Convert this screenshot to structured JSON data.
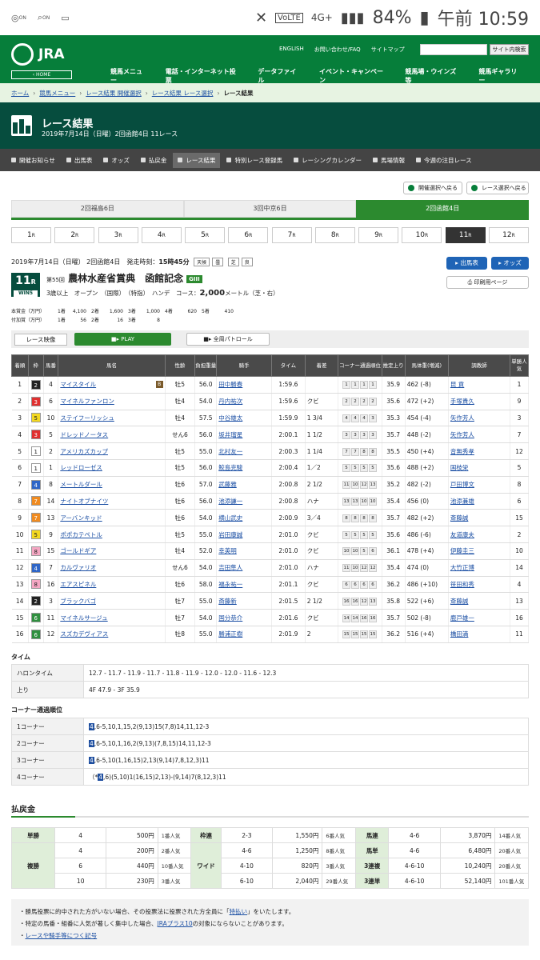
{
  "status": {
    "on1": "ON",
    "on2": "ON",
    "net": "VoLTE",
    "net2": "4G+",
    "battery": "84%",
    "time": "午前 10:59"
  },
  "header": {
    "logo": "JRA",
    "home": "‹ HOME",
    "links": [
      "ENGLISH",
      "お問い合わせ/FAQ",
      "サイトマップ"
    ],
    "search_btn": "サイト内検索",
    "nav": [
      "競馬メニュー",
      "電話・インターネット投票",
      "データファイル",
      "イベント・キャンペーン",
      "競馬場・ウインズ等",
      "競馬ギャラリー"
    ]
  },
  "breadcrumb": [
    "ホーム",
    "競馬メニュー",
    "レース結果 開催選択",
    "レース結果 レース選択",
    "レース結果"
  ],
  "page": {
    "title": "レース結果",
    "subtitle": "2019年7月14日（日曜）2回函館4日 11レース"
  },
  "tabs": [
    "開催お知らせ",
    "出馬表",
    "オッズ",
    "払戻金",
    "レース結果",
    "特別レース登録馬",
    "レーシングカレンダー",
    "馬場情報",
    "今週の注目レース"
  ],
  "nav_buttons": {
    "prev": "開催選択へ戻る",
    "race": "レース選択へ戻る"
  },
  "venues": [
    "2回福島6日",
    "3回中京6日",
    "2回函館4日"
  ],
  "races": [
    "1",
    "2",
    "3",
    "4",
    "5",
    "6",
    "7",
    "8",
    "9",
    "10",
    "11",
    "12"
  ],
  "race_suffix": "R",
  "race": {
    "date": "2019年7月14日（日曜） 2回函館4日",
    "start_label": "発走時刻：",
    "start": "15時45分",
    "w1": "天候",
    "w1v": "曇",
    "w2": "芝",
    "w2v": "良",
    "num": "11",
    "num_unit": "R",
    "win5": "WIN5",
    "kai": "第55回",
    "name": "農林水産省賞典　函館記念",
    "grade": "GIII",
    "cond": "3歳以上　オープン　（国際）　（特指）　ハンデ",
    "course_label": "コース：",
    "course": "2,000",
    "course_unit": "メートル（芝・右）"
  },
  "buttons": {
    "entries": "出馬表",
    "odds": "オッズ",
    "print": "印刷用ページ"
  },
  "prize": {
    "r1": [
      "本賞金（万円）",
      "1着",
      "4,100",
      "2着",
      "1,600",
      "3着",
      "1,000",
      "4着",
      "620",
      "5着",
      "410"
    ],
    "r2": [
      "付加賞（万円）",
      "1着",
      "56",
      "2着",
      "16",
      "3着",
      "8"
    ]
  },
  "video": {
    "label": "レース映像",
    "play": "PLAY",
    "patrol": "全周パトロール"
  },
  "table_headers": [
    "着順",
    "枠",
    "馬番",
    "馬名",
    "性齢",
    "負担重量",
    "騎手",
    "タイム",
    "着差",
    "コーナー通過順位",
    "推定上り",
    "馬体重(増減)",
    "調教師",
    "単勝人気"
  ],
  "results": [
    {
      "p": "1",
      "w": "2",
      "n": "4",
      "h": "マイスタイル",
      "b": "B",
      "s": "牡5",
      "wt": "56.0",
      "j": "田中勝春",
      "t": "1:59.6",
      "d": "",
      "c": [
        "1",
        "1",
        "1",
        "1"
      ],
      "l": "35.9",
      "bw": "462 (-8)",
      "tr": "昆 貢",
      "pop": "1"
    },
    {
      "p": "2",
      "w": "3",
      "n": "6",
      "h": "マイネルファンロン",
      "b": "",
      "s": "牡4",
      "wt": "54.0",
      "j": "丹内祐次",
      "t": "1:59.6",
      "d": "クビ",
      "c": [
        "2",
        "2",
        "2",
        "2"
      ],
      "l": "35.6",
      "bw": "472 (+2)",
      "tr": "手塚貴久",
      "pop": "9"
    },
    {
      "p": "3",
      "w": "5",
      "n": "10",
      "h": "ステイフーリッシュ",
      "b": "",
      "s": "牡4",
      "wt": "57.5",
      "j": "中谷雄太",
      "t": "1:59.9",
      "d": "1 3/4",
      "c": [
        "4",
        "4",
        "4",
        "3"
      ],
      "l": "35.3",
      "bw": "454 (-4)",
      "tr": "矢作芳人",
      "pop": "3"
    },
    {
      "p": "4",
      "w": "3",
      "n": "5",
      "h": "ドレッドノータス",
      "b": "",
      "s": "せん6",
      "wt": "56.0",
      "j": "坂井瑠星",
      "t": "2:00.1",
      "d": "1 1/2",
      "c": [
        "3",
        "3",
        "3",
        "3"
      ],
      "l": "35.7",
      "bw": "448 (-2)",
      "tr": "矢作芳人",
      "pop": "7"
    },
    {
      "p": "5",
      "w": "1",
      "n": "2",
      "h": "アメリカズカップ",
      "b": "",
      "s": "牡5",
      "wt": "55.0",
      "j": "北村友一",
      "t": "2:00.3",
      "d": "1 1/4",
      "c": [
        "7",
        "7",
        "8",
        "8"
      ],
      "l": "35.5",
      "bw": "450 (+4)",
      "tr": "音無秀孝",
      "pop": "12"
    },
    {
      "p": "6",
      "w": "1",
      "n": "1",
      "h": "レッドローゼス",
      "b": "",
      "s": "牡5",
      "wt": "56.0",
      "j": "鮫島克駿",
      "t": "2:00.4",
      "d": "1／2",
      "c": [
        "5",
        "5",
        "5",
        "5"
      ],
      "l": "35.6",
      "bw": "488 (+2)",
      "tr": "国枝栄",
      "pop": "5"
    },
    {
      "p": "7",
      "w": "4",
      "n": "8",
      "h": "メートルダール",
      "b": "",
      "s": "牡6",
      "wt": "57.0",
      "j": "武藤雅",
      "t": "2:00.8",
      "d": "2 1/2",
      "c": [
        "11",
        "10",
        "12",
        "13"
      ],
      "l": "35.2",
      "bw": "482 (-2)",
      "tr": "戸田博文",
      "pop": "8"
    },
    {
      "p": "8",
      "w": "7",
      "n": "14",
      "h": "ナイトオブナイツ",
      "b": "",
      "s": "牡6",
      "wt": "56.0",
      "j": "池添謙一",
      "t": "2:00.8",
      "d": "ハナ",
      "c": [
        "13",
        "13",
        "10",
        "10"
      ],
      "l": "35.4",
      "bw": "456 (0)",
      "tr": "池添兼雄",
      "pop": "6"
    },
    {
      "p": "9",
      "w": "7",
      "n": "13",
      "h": "アーバンキッド",
      "b": "",
      "s": "牡6",
      "wt": "54.0",
      "j": "横山武史",
      "t": "2:00.9",
      "d": "3／4",
      "c": [
        "8",
        "8",
        "8",
        "8"
      ],
      "l": "35.7",
      "bw": "482 (+2)",
      "tr": "斎藤誠",
      "pop": "15"
    },
    {
      "p": "10",
      "w": "5",
      "n": "9",
      "h": "ポポカテペトル",
      "b": "",
      "s": "牡5",
      "wt": "55.0",
      "j": "岩田康誠",
      "t": "2:01.0",
      "d": "クビ",
      "c": [
        "5",
        "5",
        "5",
        "5"
      ],
      "l": "35.6",
      "bw": "486 (-6)",
      "tr": "友道康夫",
      "pop": "2"
    },
    {
      "p": "11",
      "w": "8",
      "n": "15",
      "h": "ゴールドギア",
      "b": "",
      "s": "牡4",
      "wt": "52.0",
      "j": "幸英明",
      "t": "2:01.0",
      "d": "クビ",
      "c": [
        "10",
        "10",
        "5",
        "6"
      ],
      "l": "36.1",
      "bw": "478 (+4)",
      "tr": "伊藤圭三",
      "pop": "10"
    },
    {
      "p": "12",
      "w": "4",
      "n": "7",
      "h": "カルヴァリオ",
      "b": "",
      "s": "せん6",
      "wt": "54.0",
      "j": "吉田隼人",
      "t": "2:01.0",
      "d": "ハナ",
      "c": [
        "11",
        "10",
        "12",
        "12"
      ],
      "l": "35.4",
      "bw": "474 (0)",
      "tr": "大竹正博",
      "pop": "14"
    },
    {
      "p": "13",
      "w": "8",
      "n": "16",
      "h": "エアスピネル",
      "b": "",
      "s": "牡6",
      "wt": "58.0",
      "j": "福永祐一",
      "t": "2:01.1",
      "d": "クビ",
      "c": [
        "6",
        "6",
        "6",
        "6"
      ],
      "l": "36.2",
      "bw": "486 (+10)",
      "tr": "笹田和秀",
      "pop": "4"
    },
    {
      "p": "14",
      "w": "2",
      "n": "3",
      "h": "ブラックバゴ",
      "b": "",
      "s": "牡7",
      "wt": "55.0",
      "j": "斎藤新",
      "t": "2:01.5",
      "d": "2 1/2",
      "c": [
        "16",
        "16",
        "12",
        "13"
      ],
      "l": "35.8",
      "bw": "522 (+6)",
      "tr": "斎藤誠",
      "pop": "13"
    },
    {
      "p": "15",
      "w": "6",
      "n": "11",
      "h": "マイネルサージュ",
      "b": "",
      "s": "牡7",
      "wt": "54.0",
      "j": "国分恭介",
      "t": "2:01.6",
      "d": "クビ",
      "c": [
        "14",
        "14",
        "16",
        "16"
      ],
      "l": "35.7",
      "bw": "502 (-8)",
      "tr": "鹿戸雄一",
      "pop": "16"
    },
    {
      "p": "16",
      "w": "6",
      "n": "12",
      "h": "スズカデヴィアス",
      "b": "",
      "s": "牡8",
      "wt": "55.0",
      "j": "勝浦正樹",
      "t": "2:01.9",
      "d": "2",
      "c": [
        "15",
        "15",
        "15",
        "15"
      ],
      "l": "36.2",
      "bw": "516 (+4)",
      "tr": "橋田満",
      "pop": "11"
    }
  ],
  "waku_colors": {
    "1": "#ffffff",
    "2": "#222222",
    "3": "#e03030",
    "4": "#2f66c7",
    "5": "#f3d820",
    "6": "#2f8f3f",
    "7": "#f08b20",
    "8": "#f5a7c3"
  },
  "timing": {
    "head": "タイム",
    "rows": [
      [
        "ハロンタイム",
        "12.7 - 11.7 - 11.9 - 11.7 - 11.8 - 11.9 - 12.0 - 12.0 - 11.6 - 12.3"
      ],
      [
        "上り",
        "4F 47.9 - 3F 35.9"
      ]
    ]
  },
  "corner": {
    "head": "コーナー通過順位",
    "rows": [
      [
        "1コーナー",
        "4",
        ",6-5,10,1,15,2(9,13)15(7,8)14,11,12-3"
      ],
      [
        "2コーナー",
        "4",
        ",6-5,10,1,16,2(9,13)(7,8,15)14,11,12-3"
      ],
      [
        "3コーナー",
        "4",
        ",6-5,10(1,16,15)2,13(9,14)7,8,12,3)11"
      ],
      [
        "4コーナー",
        "4",
        ",6)(5,10)1(16,15)2,13)-(9,14)7(8,12,3)11"
      ]
    ],
    "pre": "（*"
  },
  "payout": {
    "head": "払戻金",
    "rows": [
      [
        "単勝",
        "4",
        "500円",
        "1番人気",
        "枠連",
        "2-3",
        "1,550円",
        "6番人気",
        "馬連",
        "4-6",
        "3,870円",
        "14番人気"
      ],
      [
        "複勝",
        "4",
        "200円",
        "2番人気",
        "ワイド",
        "4-6",
        "1,250円",
        "8番人気",
        "馬単",
        "4-6",
        "6,480円",
        "20番人気"
      ],
      [
        "",
        "6",
        "440円",
        "10番人気",
        "",
        "4-10",
        "820円",
        "3番人気",
        "3連複",
        "4-6-10",
        "10,240円",
        "20番人気"
      ],
      [
        "",
        "10",
        "230円",
        "3番人気",
        "",
        "6-10",
        "2,040円",
        "29番人気",
        "3連単",
        "4-6-10",
        "52,140円",
        "101番人気"
      ]
    ]
  },
  "notes": {
    "n1a": "勝馬投票に的中された方がいない場合、その投票法に投票された方全員に「",
    "n1l": "特払い",
    "n1b": "」をいたします。",
    "n2a": "特定の馬番・組番に人気が著しく集中した場合、",
    "n2l": "JRAプラス10",
    "n2b": "の対象にならないことがあります。",
    "n3l": "レースや騎手等につく記号"
  }
}
